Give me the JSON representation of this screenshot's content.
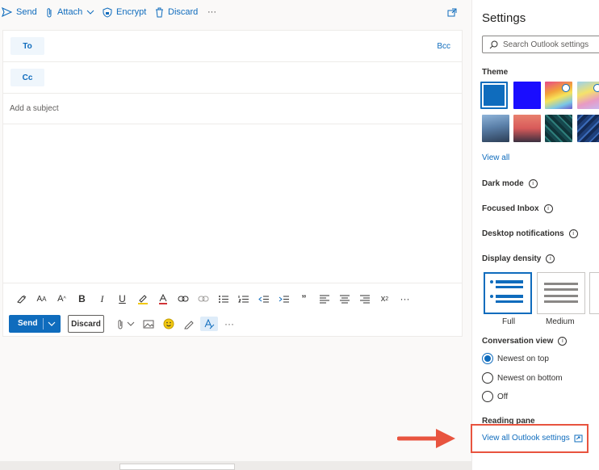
{
  "toolbar": {
    "send": "Send",
    "attach": "Attach",
    "encrypt": "Encrypt",
    "discard": "Discard",
    "more": "···"
  },
  "compose": {
    "to_label": "To",
    "cc_label": "Cc",
    "bcc_label": "Bcc",
    "subject_placeholder": "Add a subject"
  },
  "format_bar": {
    "icons": [
      "format-painter-icon",
      "font-size-icon",
      "grow-font-icon",
      "bold-icon",
      "italic-icon",
      "underline-icon",
      "highlight-icon",
      "font-color-icon",
      "link-icon",
      "unlink-icon",
      "bullets-icon",
      "numbering-icon",
      "decrease-indent-icon",
      "increase-indent-icon",
      "quote-icon",
      "align-left-icon",
      "align-center-icon",
      "align-right-icon",
      "superscript-icon",
      "more-formatting-icon"
    ]
  },
  "send_row": {
    "send": "Send",
    "discard": "Discard",
    "more": "···"
  },
  "settings": {
    "title": "Settings",
    "search_placeholder": "Search Outlook settings",
    "theme_heading": "Theme",
    "view_all": "View all",
    "dark_mode": "Dark mode",
    "focused_inbox": "Focused Inbox",
    "desktop_notifications": "Desktop notifications",
    "display_density": "Display density",
    "density_options": [
      "Full",
      "Medium"
    ],
    "conversation_view": "Conversation view",
    "conversation_options": [
      "Newest on top",
      "Newest on bottom",
      "Off"
    ],
    "conversation_selected": "Newest on top",
    "reading_pane": "Reading pane",
    "view_all_outlook_settings": "View all Outlook settings"
  },
  "colors": {
    "accent": "#0f6cbd",
    "highlight_box": "#e8543f"
  }
}
